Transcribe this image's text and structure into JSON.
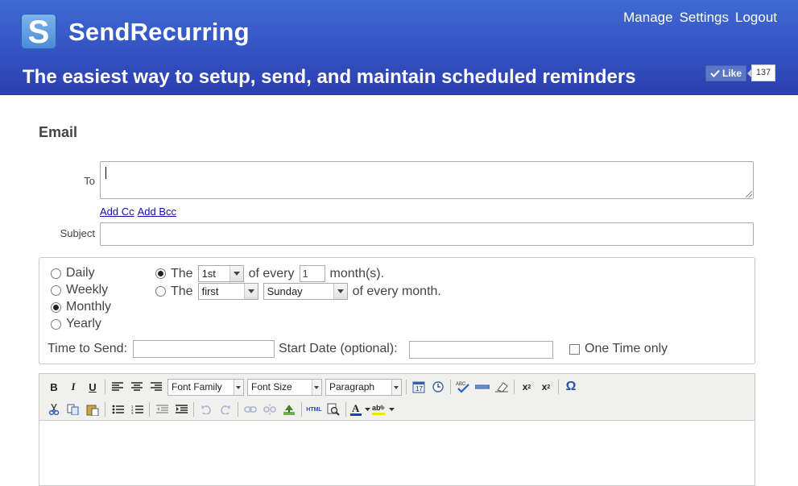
{
  "header": {
    "logo_letter": "S",
    "brand": "SendRecurring",
    "nav": [
      "Manage",
      "Settings",
      "Logout"
    ],
    "tagline": "The easiest way to setup, send, and maintain scheduled reminders",
    "like_label": "Like",
    "like_count": "137"
  },
  "form": {
    "section_title": "Email",
    "to_label": "To",
    "add_cc": "Add Cc",
    "add_bcc": "Add Bcc",
    "subject_label": "Subject"
  },
  "recurrence": {
    "frequencies": [
      "Daily",
      "Weekly",
      "Monthly",
      "Yearly"
    ],
    "selected_frequency": "Monthly",
    "option1": {
      "prefix": "The",
      "day_value": "1st",
      "middle": "of every",
      "months_value": "1",
      "suffix": "month(s)."
    },
    "option2": {
      "prefix": "The",
      "ordinal_value": "first",
      "weekday_value": "Sunday",
      "suffix": "of every month."
    },
    "time_label": "Time to Send:",
    "start_label": "Start Date (optional):",
    "one_time_label": "One Time only"
  },
  "editor": {
    "font_family": "Font Family",
    "font_size": "Font Size",
    "format": "Paragraph",
    "row1_icons": [
      "bold-icon",
      "italic-icon",
      "underline-icon",
      "align-left-icon",
      "align-center-icon",
      "align-right-icon",
      "insert-date-icon",
      "insert-time-icon",
      "spellcheck-icon",
      "horizontal-rule-icon",
      "remove-format-icon",
      "subscript-icon",
      "superscript-icon",
      "special-char-icon"
    ],
    "row2_icons": [
      "cut-icon",
      "copy-icon",
      "paste-icon",
      "bullet-list-icon",
      "numbered-list-icon",
      "outdent-icon",
      "indent-icon",
      "undo-icon",
      "redo-icon",
      "link-icon",
      "unlink-icon",
      "image-icon",
      "html-icon",
      "preview-icon",
      "text-color-icon",
      "highlight-color-icon"
    ],
    "accent_colors": {
      "text_color": "#1a3fb5",
      "highlight": "#e8e800"
    }
  },
  "colors": {
    "header_top": "#3f6ad2",
    "header_bottom": "#2c3fb0",
    "link": "#1a0dab"
  }
}
